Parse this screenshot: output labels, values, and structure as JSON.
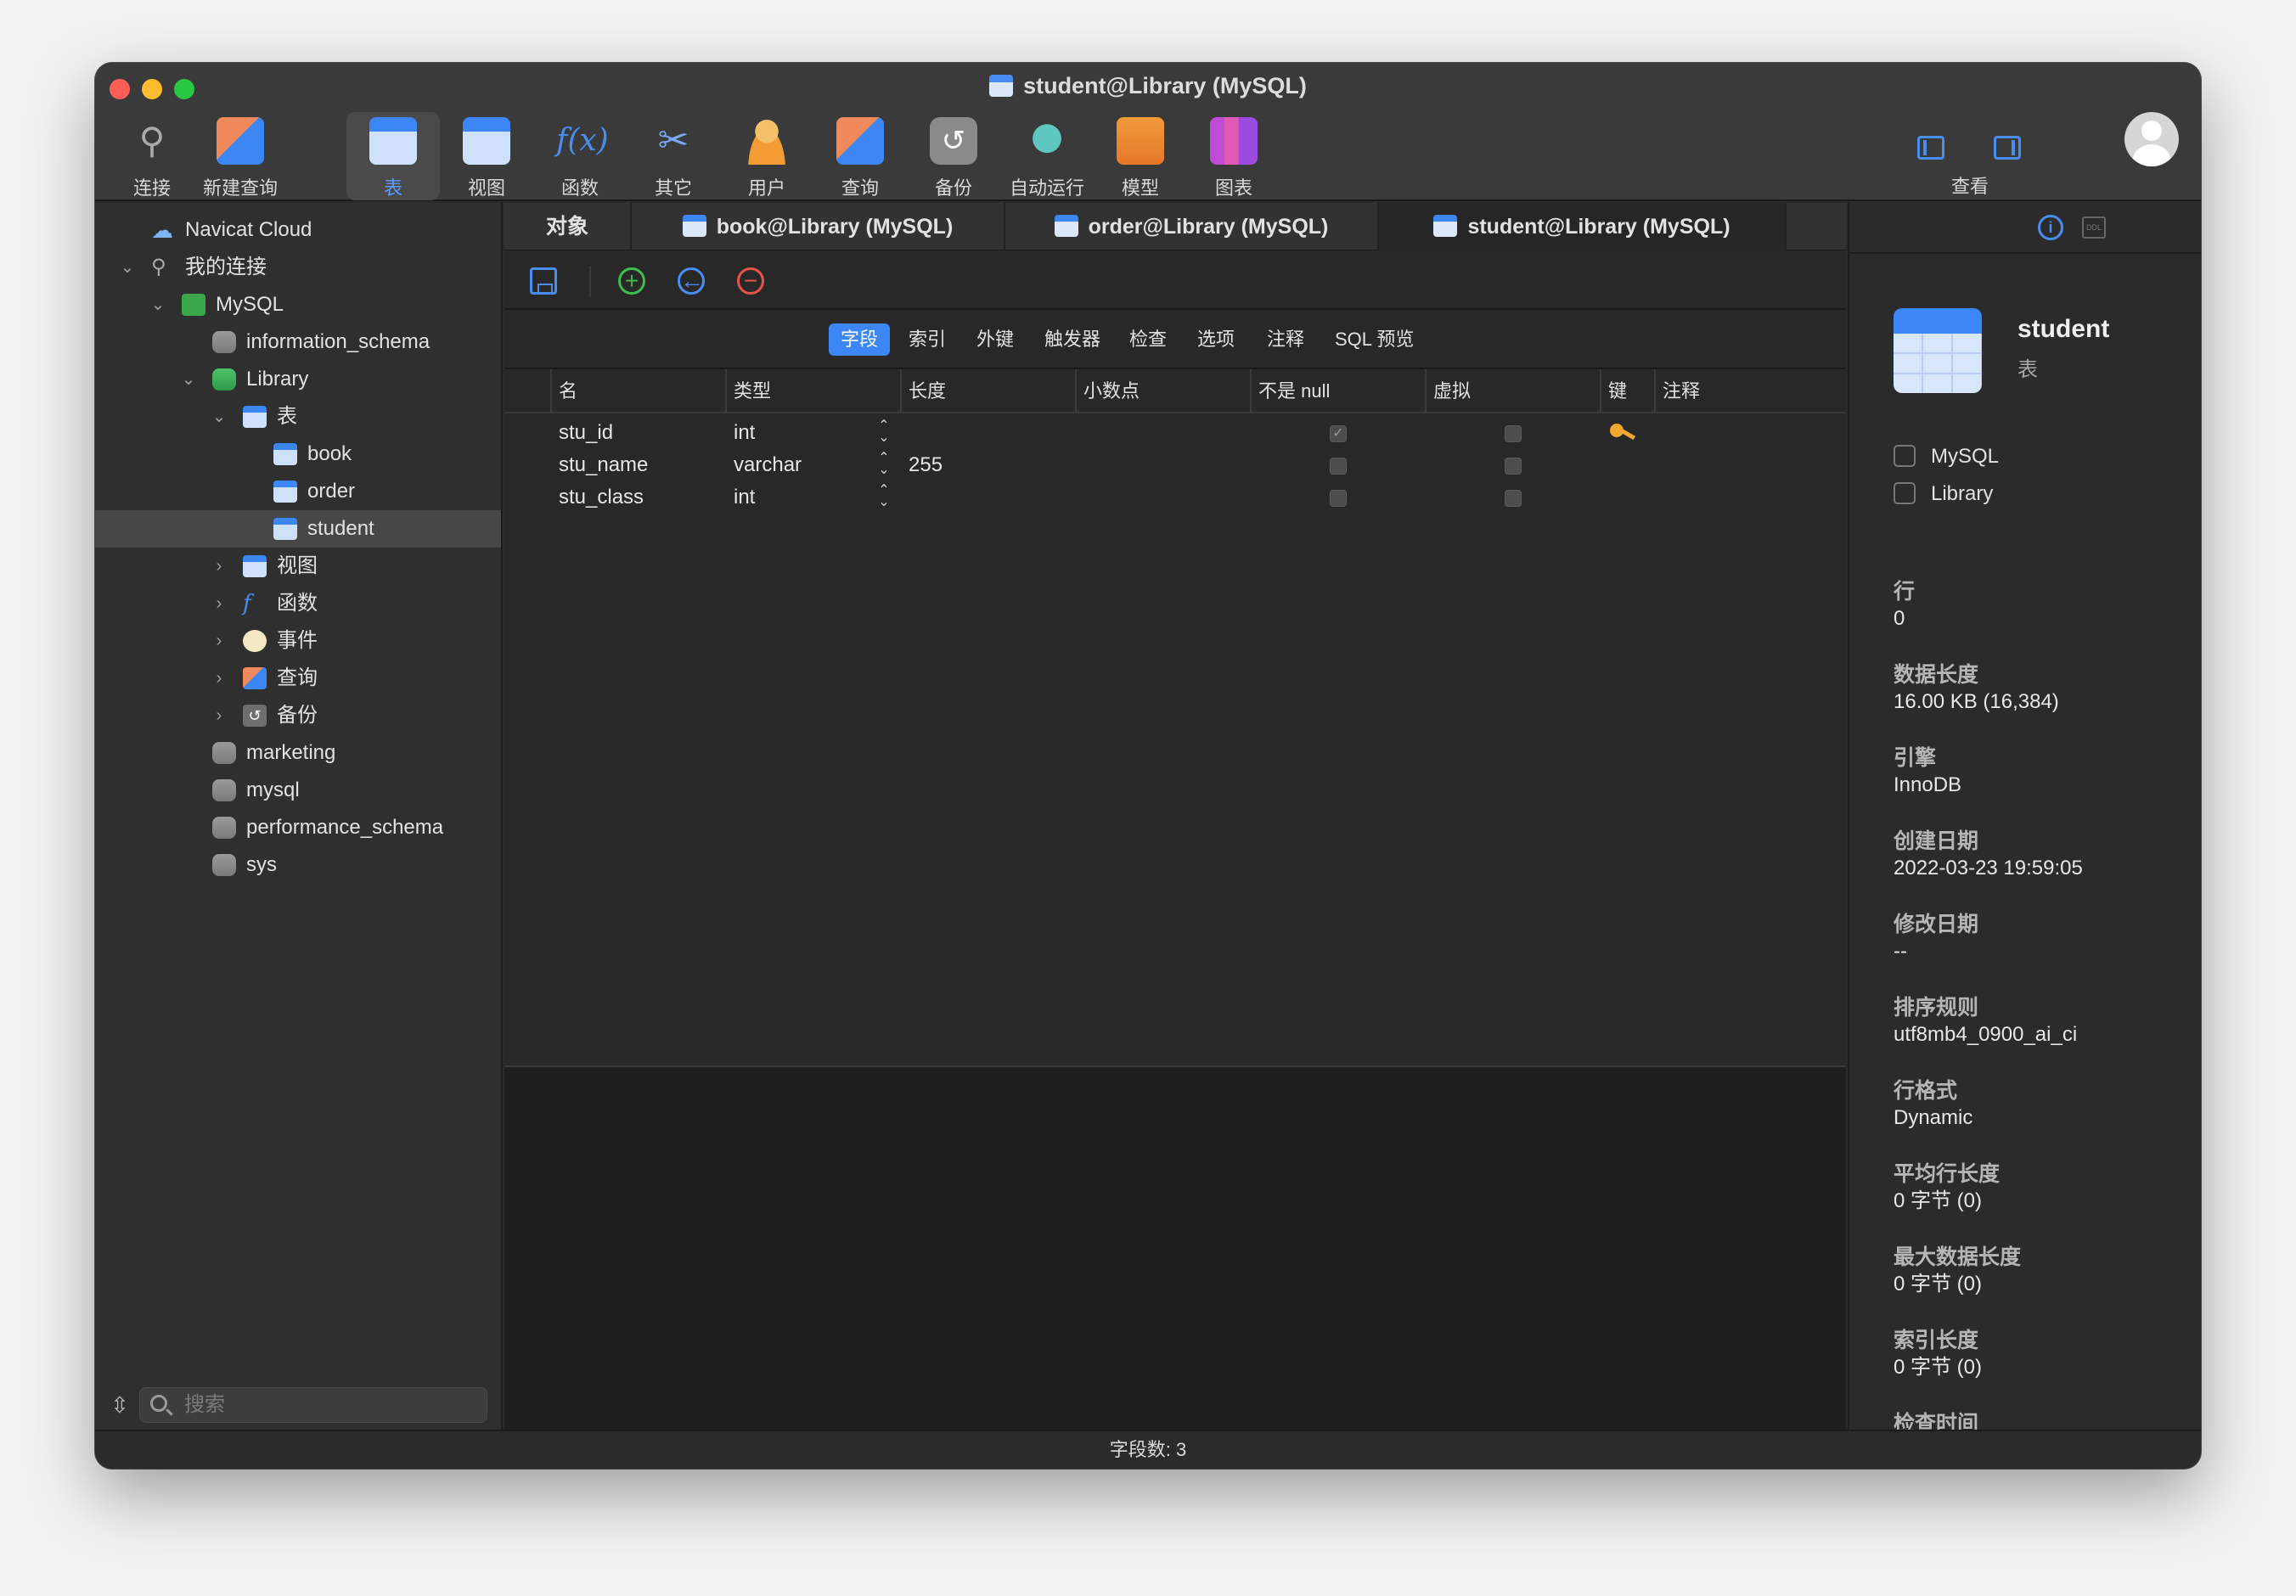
{
  "window": {
    "title": "student@Library (MySQL)"
  },
  "toolbar": {
    "items": [
      {
        "label": "连接",
        "icon": "plug-icon"
      },
      {
        "label": "新建查询",
        "icon": "new-query-icon"
      },
      {
        "label": "表",
        "icon": "table-icon",
        "active": true
      },
      {
        "label": "视图",
        "icon": "view-icon"
      },
      {
        "label": "函数",
        "icon": "function-icon"
      },
      {
        "label": "其它",
        "icon": "tools-icon"
      },
      {
        "label": "用户",
        "icon": "user-icon"
      },
      {
        "label": "查询",
        "icon": "query-icon"
      },
      {
        "label": "备份",
        "icon": "backup-icon"
      },
      {
        "label": "自动运行",
        "icon": "robot-icon"
      },
      {
        "label": "模型",
        "icon": "model-icon"
      },
      {
        "label": "图表",
        "icon": "chart-icon"
      }
    ],
    "view_label": "查看",
    "func_glyph": "f(x)"
  },
  "sidebar": {
    "tree": [
      {
        "label": "Navicat Cloud"
      },
      {
        "label": "我的连接"
      },
      {
        "label": "MySQL"
      },
      {
        "label": "information_schema"
      },
      {
        "label": "Library"
      },
      {
        "label": "表"
      },
      {
        "label": "book"
      },
      {
        "label": "order"
      },
      {
        "label": "student",
        "selected": true
      },
      {
        "label": "视图"
      },
      {
        "label": "函数"
      },
      {
        "label": "事件"
      },
      {
        "label": "查询"
      },
      {
        "label": "备份"
      },
      {
        "label": "marketing"
      },
      {
        "label": "mysql"
      },
      {
        "label": "performance_schema"
      },
      {
        "label": "sys"
      }
    ],
    "search_placeholder": "搜索"
  },
  "tabs": [
    {
      "label": "对象"
    },
    {
      "label": "book@Library (MySQL)"
    },
    {
      "label": "order@Library (MySQL)"
    },
    {
      "label": "student@Library (MySQL)",
      "active": true
    }
  ],
  "subtabs": [
    "字段",
    "索引",
    "外键",
    "触发器",
    "检查",
    "选项",
    "注释",
    "SQL 预览"
  ],
  "grid": {
    "columns": [
      "名",
      "类型",
      "长度",
      "小数点",
      "不是 null",
      "虚拟",
      "键",
      "注释"
    ],
    "rows": [
      {
        "name": "stu_id",
        "type": "int",
        "length": "",
        "not_null": true,
        "virtual": false,
        "key": true
      },
      {
        "name": "stu_name",
        "type": "varchar",
        "length": "255",
        "not_null": false,
        "virtual": false,
        "key": false
      },
      {
        "name": "stu_class",
        "type": "int",
        "length": "",
        "not_null": false,
        "virtual": false,
        "key": false
      }
    ]
  },
  "info": {
    "name": "student",
    "type": "表",
    "connection": "MySQL",
    "database": "Library",
    "ddl_label": "DDL",
    "properties": [
      {
        "label": "行",
        "value": "0"
      },
      {
        "label": "数据长度",
        "value": "16.00 KB (16,384)"
      },
      {
        "label": "引擎",
        "value": "InnoDB"
      },
      {
        "label": "创建日期",
        "value": "2022-03-23 19:59:05"
      },
      {
        "label": "修改日期",
        "value": "--"
      },
      {
        "label": "排序规则",
        "value": "utf8mb4_0900_ai_ci"
      },
      {
        "label": "行格式",
        "value": "Dynamic"
      },
      {
        "label": "平均行长度",
        "value": "0 字节 (0)"
      },
      {
        "label": "最大数据长度",
        "value": "0 字节 (0)"
      },
      {
        "label": "索引长度",
        "value": "0 字节 (0)"
      },
      {
        "label": "检查时间",
        "value": ""
      }
    ]
  },
  "status": {
    "text": "字段数: 3"
  },
  "colors": {
    "accent": "#3d86f5",
    "add": "#3dbd4d",
    "remove": "#e5534b",
    "key": "#f0a92c"
  }
}
